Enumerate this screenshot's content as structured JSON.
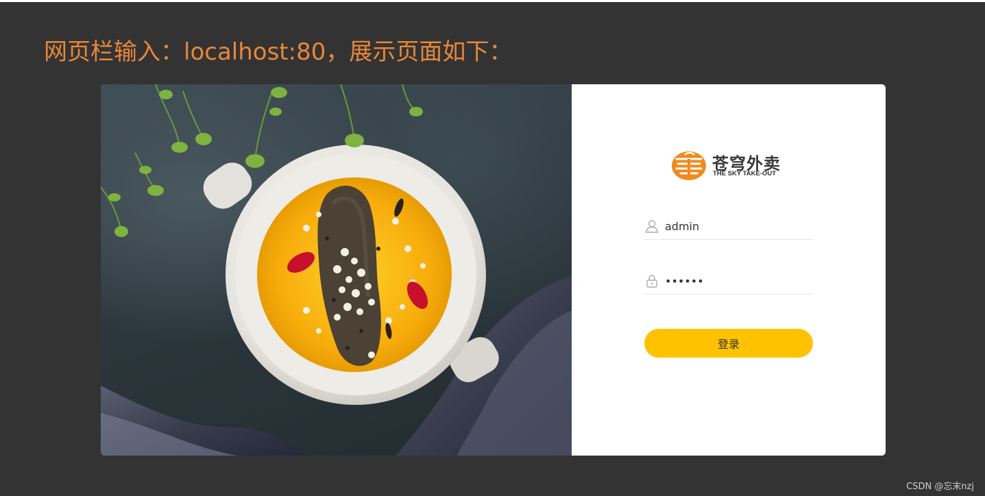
{
  "heading": "网页栏输入：localhost:80，展示页面如下：",
  "colors": {
    "background": "#333333",
    "heading": "#e8883a",
    "accent": "#ffc200",
    "logo_orange": "#f08a1c"
  },
  "photo": {
    "subject": "food-photo"
  },
  "login": {
    "logo": {
      "name_cn": "苍穹外卖",
      "name_en": "THE SKY TAKE-OUT"
    },
    "username": {
      "icon": "user-icon",
      "value": "admin"
    },
    "password": {
      "icon": "lock-icon",
      "value": "••••••"
    },
    "submit_label": "登录"
  },
  "watermark": "CSDN @忘末nzj"
}
